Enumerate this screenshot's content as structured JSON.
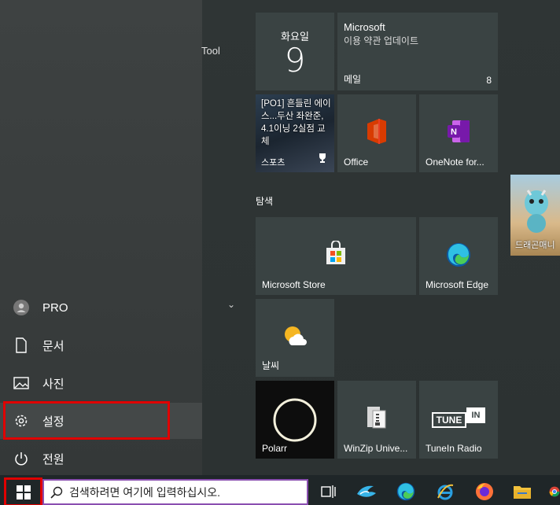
{
  "left_rail": {
    "user": "PRO",
    "documents": "문서",
    "pictures": "사진",
    "settings": "설정",
    "power": "전원"
  },
  "tool_label": "Tool",
  "tiles": {
    "calendar": {
      "weekday": "화요일",
      "day": "9"
    },
    "mail": {
      "sender": "Microsoft",
      "subject": "이용 약관 업데이트",
      "name": "메일",
      "count": "8"
    },
    "news": {
      "headline": "[PO1] 흔들린 에이스...두산 좌완준, 4.1이닝 2실점 교체",
      "category": "스포츠"
    },
    "office": {
      "name": "Office"
    },
    "onenote": {
      "name": "OneNote for..."
    },
    "store": {
      "name": "Microsoft Store"
    },
    "edge": {
      "name": "Microsoft Edge"
    },
    "weather": {
      "name": "날씨"
    },
    "polarr": {
      "name": "Polarr"
    },
    "winzip": {
      "name": "WinZip Unive..."
    },
    "tunein": {
      "name": "TuneIn Radio",
      "logo_left": "TUNE",
      "logo_right": "IN"
    },
    "dragon": {
      "name": "드래곤매니"
    }
  },
  "section_explore": "탐색",
  "taskbar": {
    "search_placeholder": "검색하려면 여기에 입력하십시오."
  },
  "colors": {
    "highlight": "#e00000",
    "search_border": "#8a4fb0",
    "tile_bg": "#3a4343"
  }
}
